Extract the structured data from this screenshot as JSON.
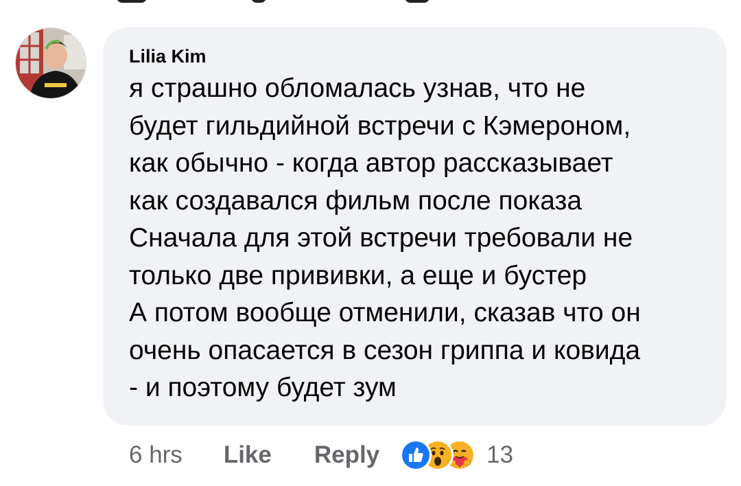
{
  "comment": {
    "author": "Lilia Kim",
    "lines": [
      "я страшно обломалась узнав, что не",
      "будет гильдийной встречи с Кэмероном,",
      "как обычно - когда автор рассказывает",
      "как создавался фильм после показа",
      "Сначала для этой встречи требовали не",
      "только две прививки, а еще и бустер",
      "А потом вообще отменили, сказав что он",
      "очень опасается в сезон гриппа и ковида",
      "- и поэтому будет зум"
    ],
    "timestamp": "6 hrs",
    "like_label": "Like",
    "reply_label": "Reply",
    "reactions": [
      "like-icon",
      "wow-icon",
      "care-icon"
    ],
    "reaction_count": "13"
  },
  "colors": {
    "bubble_bg": "#f0f2f5",
    "text": "#050505",
    "secondary": "#65676b",
    "like_blue": "#1877f2",
    "emoji_yellow": "#f7b125"
  }
}
